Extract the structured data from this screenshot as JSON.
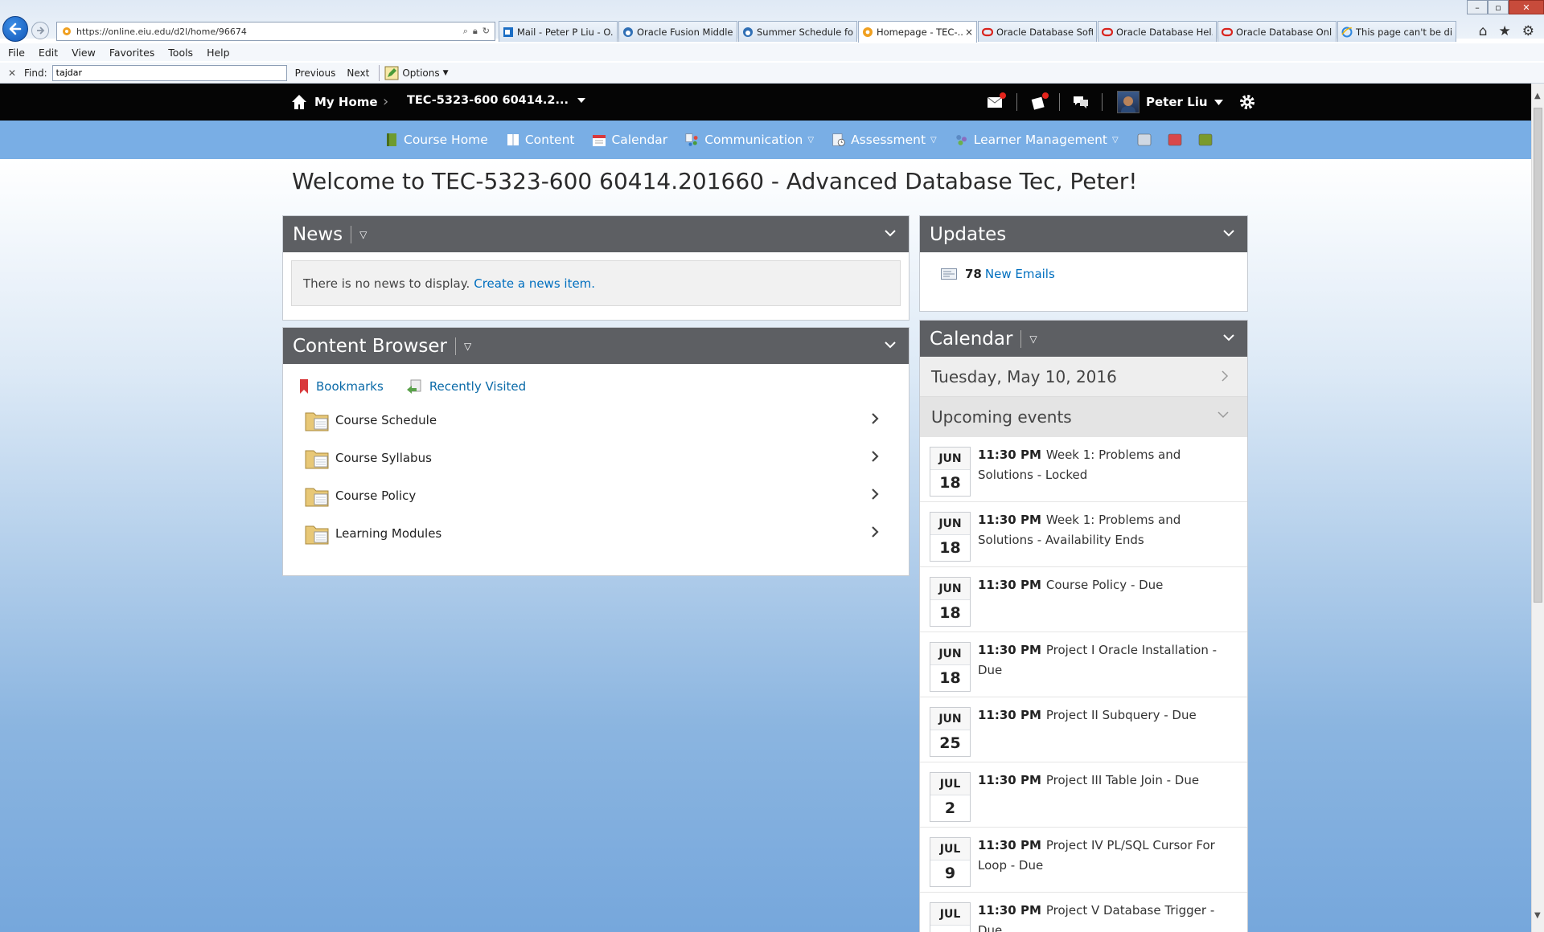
{
  "browser": {
    "url": "https://online.eiu.edu/d2l/home/96674",
    "tabs": [
      {
        "label": "Mail - Peter P Liu - O...",
        "icon": "outlook-icon"
      },
      {
        "label": "Oracle Fusion Middle...",
        "icon": "cloud-icon"
      },
      {
        "label": "Summer Schedule fo...",
        "icon": "cloud-icon"
      },
      {
        "label": "Homepage - TEC-...",
        "icon": "d2l-icon",
        "active": true
      },
      {
        "label": "Oracle Database Soft...",
        "icon": "oracle-icon"
      },
      {
        "label": "Oracle Database Hel...",
        "icon": "oracle-icon"
      },
      {
        "label": "Oracle Database Onli...",
        "icon": "oracle-icon"
      },
      {
        "label": "This page can't be di...",
        "icon": "ie-icon"
      }
    ],
    "tab_close": "×",
    "menu": [
      "File",
      "Edit",
      "View",
      "Favorites",
      "Tools",
      "Help"
    ],
    "find": {
      "label": "Find:",
      "value": "tajdar",
      "previous": "Previous",
      "next": "Next",
      "options": "Options"
    }
  },
  "lms": {
    "home_label": "My Home",
    "course_label": "TEC-5323-600 60414.2...",
    "user_name": "Peter Liu",
    "subnav": [
      {
        "label": "Course Home",
        "icon": "book-icon",
        "dropdown": false
      },
      {
        "label": "Content",
        "icon": "content-icon",
        "dropdown": false
      },
      {
        "label": "Calendar",
        "icon": "calendar-icon",
        "dropdown": false
      },
      {
        "label": "Communication",
        "icon": "communication-icon",
        "dropdown": true
      },
      {
        "label": "Assessment",
        "icon": "assessment-icon",
        "dropdown": true
      },
      {
        "label": "Learner Management",
        "icon": "learner-icon",
        "dropdown": true
      }
    ],
    "welcome": "Welcome to TEC-5323-600 60414.201660 - Advanced Database Tec, Peter!",
    "news": {
      "title": "News",
      "empty_text": "There is no news to display.",
      "create_link": "Create a news item."
    },
    "content_browser": {
      "title": "Content Browser",
      "bookmarks": "Bookmarks",
      "recently_visited": "Recently Visited",
      "items": [
        "Course Schedule",
        "Course Syllabus",
        "Course Policy",
        "Learning Modules"
      ]
    },
    "updates": {
      "title": "Updates",
      "count": "78",
      "label": "New Emails"
    },
    "calendar": {
      "title": "Calendar",
      "date": "Tuesday, May 10, 2016",
      "upcoming": "Upcoming events",
      "events": [
        {
          "mon": "JUN",
          "day": "18",
          "time": "11:30 PM",
          "text": "Week 1: Problems and Solutions - Locked"
        },
        {
          "mon": "JUN",
          "day": "18",
          "time": "11:30 PM",
          "text": "Week 1: Problems and Solutions - Availability Ends"
        },
        {
          "mon": "JUN",
          "day": "18",
          "time": "11:30 PM",
          "text": "Course Policy - Due"
        },
        {
          "mon": "JUN",
          "day": "18",
          "time": "11:30 PM",
          "text": "Project I Oracle Installation - Due"
        },
        {
          "mon": "JUN",
          "day": "25",
          "time": "11:30 PM",
          "text": "Project II Subquery - Due"
        },
        {
          "mon": "JUL",
          "day": "2",
          "time": "11:30 PM",
          "text": "Project III Table Join - Due"
        },
        {
          "mon": "JUL",
          "day": "9",
          "time": "11:30 PM",
          "text": "Project IV PL/SQL Cursor For Loop - Due"
        },
        {
          "mon": "JUL",
          "day": "",
          "time": "11:30 PM",
          "text": "Project V Database Trigger - Due"
        }
      ]
    }
  },
  "colors": {
    "topnav": "#050505",
    "subnav": "#79aee5",
    "widget_header": "#5d5f63",
    "link": "#006fbf"
  }
}
